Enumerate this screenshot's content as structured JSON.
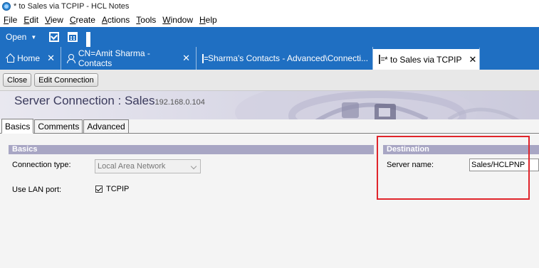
{
  "window": {
    "title": "* to Sales via TCPIP - HCL Notes"
  },
  "menu": [
    "File",
    "Edit",
    "View",
    "Create",
    "Actions",
    "Tools",
    "Window",
    "Help"
  ],
  "toolbar": {
    "open_label": "Open"
  },
  "tabs": [
    {
      "label": "Home",
      "icon": "home-icon"
    },
    {
      "label": "CN=Amit Sharma - Contacts",
      "icon": "person-icon"
    },
    {
      "label": "Sharma's Contacts - Advanced\\Connecti...",
      "icon": "document-icon"
    },
    {
      "label": "* to Sales via TCPIP",
      "icon": "document-icon",
      "active": true
    }
  ],
  "actions": {
    "close_label": "Close",
    "edit_label": "Edit Connection"
  },
  "header": {
    "title": "Server Connection : Sales",
    "ip": "192.168.0.104"
  },
  "form_tabs": [
    "Basics",
    "Comments",
    "Advanced"
  ],
  "basics": {
    "heading": "Basics",
    "connection_type_label": "Connection type:",
    "connection_type_value": "Local Area Network",
    "lan_port_label": "Use LAN port:",
    "lan_port_value": "TCPIP"
  },
  "destination": {
    "heading": "Destination",
    "server_name_label": "Server name:",
    "server_name_value": "Sales/HCLPNP"
  },
  "colors": {
    "brand_blue": "#1f6fc2",
    "section_header": "#a8a6c4",
    "highlight_red": "#e0242b"
  }
}
